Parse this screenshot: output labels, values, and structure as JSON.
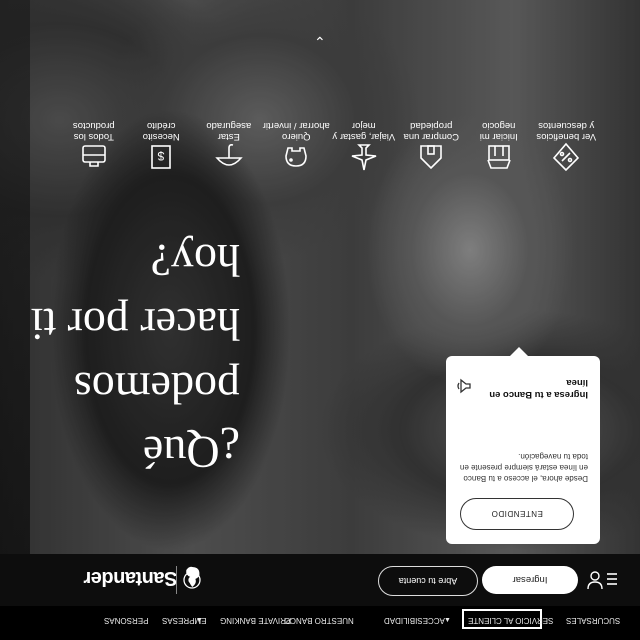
{
  "hero": {
    "headline_lines": [
      "¿Qué",
      "podemos",
      "hacer por ti",
      "hoy?"
    ]
  },
  "tiles": [
    {
      "label_lines": [
        "Todos los",
        "productos"
      ],
      "icon": "briefcase-icon"
    },
    {
      "label_lines": [
        "Necesito",
        "crédito"
      ],
      "icon": "document-money-icon"
    },
    {
      "label_lines": [
        "Estar",
        "asegurado"
      ],
      "icon": "umbrella-icon"
    },
    {
      "label_lines": [
        "Quiero",
        "ahorrar / invertir"
      ],
      "icon": "piggy-bank-icon"
    },
    {
      "label_lines": [
        "Viajar, gastar y",
        "mejor"
      ],
      "icon": "plane-icon"
    },
    {
      "label_lines": [
        "Comprar una",
        "propiedad"
      ],
      "icon": "house-icon"
    },
    {
      "label_lines": [
        "Iniciar mi",
        "negocio"
      ],
      "icon": "store-icon"
    },
    {
      "label_lines": [
        "Ver beneficios",
        "y descuentos"
      ],
      "icon": "discount-tag-icon"
    }
  ],
  "popup": {
    "button": "ENTENDIDO",
    "title": "Ingresa a tu Banco en línea",
    "message": "Desde ahora, el acceso a tu Banco en línea estará siempre presente en toda tu navegación."
  },
  "mainbar": {
    "brand": "Santander",
    "abre_label": "Abre tu cuenta",
    "ingresar_label": "Ingresar"
  },
  "subbar": {
    "personas": "PERSONAS",
    "empresas": "EMPRESAS",
    "private": "PRIVATE BANKING",
    "nuestro": "NUESTRO BANCO",
    "accesibilidad": "ACCESIBILIDAD",
    "servicio": "SERVICIO AL CLIENTE",
    "sucursales": "SUCURSALES"
  },
  "colors": {
    "brand_red": "#ec0000",
    "bar_bg": "#0d0d0d",
    "text": "#ffffff"
  }
}
